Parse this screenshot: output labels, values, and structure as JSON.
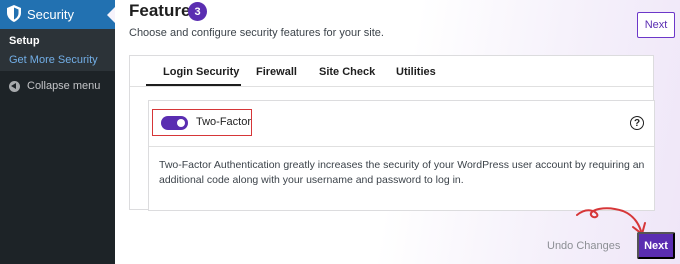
{
  "sidebar": {
    "menu_title": "Security",
    "items": [
      {
        "label": "Setup"
      },
      {
        "label": "Get More Security"
      }
    ],
    "collapse_label": "Collapse menu"
  },
  "header": {
    "title": "Features",
    "badge_count": "3",
    "subtitle": "Choose and configure security features for your site.",
    "next_label": "Next"
  },
  "tabs": [
    {
      "label": "Login Security",
      "active": true
    },
    {
      "label": "Firewall"
    },
    {
      "label": "Site Check"
    },
    {
      "label": "Utilities"
    }
  ],
  "feature": {
    "toggle_on": true,
    "label": "Two-Factor",
    "help_glyph": "?",
    "description": "Two-Factor Authentication greatly increases the security of your WordPress user account by requiring an additional code along with your username and password to log in."
  },
  "footer": {
    "undo_label": "Undo Changes",
    "next_label": "Next"
  },
  "colors": {
    "accent": "#5a2db1",
    "sidebar_bg": "#1d2327",
    "sidebar_active": "#2271b1",
    "highlight": "#d63638"
  }
}
